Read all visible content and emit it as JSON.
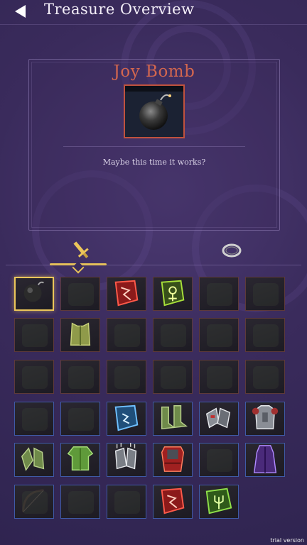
{
  "header": {
    "title": "Treasure Overview",
    "back_icon": "back-arrow-icon"
  },
  "detail": {
    "item_name": "Joy Bomb",
    "item_icon": "bomb-icon",
    "description": "Maybe this time it works?",
    "name_color": "#d2664f"
  },
  "tabs": [
    {
      "icon": "sword-icon",
      "selected": true
    },
    {
      "icon": "ring-icon",
      "selected": false
    }
  ],
  "slots": [
    {
      "icon": "bomb-icon",
      "state": "selected"
    },
    {
      "icon": "empty-slot-icon",
      "state": "locked"
    },
    {
      "icon": "red-rune-icon",
      "state": "owned"
    },
    {
      "icon": "green-rune-icon",
      "state": "owned"
    },
    {
      "icon": "locked-item-icon",
      "state": "locked"
    },
    {
      "icon": "locked-item-icon",
      "state": "locked"
    },
    {
      "icon": "locked-item-icon",
      "state": "locked"
    },
    {
      "icon": "leather-vest-icon",
      "state": "owned"
    },
    {
      "icon": "locked-item-icon",
      "state": "locked"
    },
    {
      "icon": "locked-item-icon",
      "state": "locked"
    },
    {
      "icon": "locked-item-icon",
      "state": "locked"
    },
    {
      "icon": "locked-item-icon",
      "state": "locked"
    },
    {
      "icon": "locked-item-icon",
      "state": "locked"
    },
    {
      "icon": "locked-item-icon",
      "state": "locked"
    },
    {
      "icon": "locked-item-icon",
      "state": "locked"
    },
    {
      "icon": "locked-item-icon",
      "state": "locked"
    },
    {
      "icon": "locked-item-icon",
      "state": "locked"
    },
    {
      "icon": "locked-item-icon",
      "state": "locked"
    },
    {
      "icon": "locked-item-icon",
      "state": "locked"
    },
    {
      "icon": "locked-item-icon",
      "state": "locked"
    },
    {
      "icon": "blue-rune-icon",
      "state": "owned"
    },
    {
      "icon": "green-boots-icon",
      "state": "owned"
    },
    {
      "icon": "steel-gauntlets-icon",
      "state": "owned"
    },
    {
      "icon": "plate-armor-icon",
      "state": "owned"
    },
    {
      "icon": "green-gloves-icon",
      "state": "owned"
    },
    {
      "icon": "green-tunic-icon",
      "state": "owned"
    },
    {
      "icon": "clawed-gauntlets-icon",
      "state": "owned"
    },
    {
      "icon": "red-armor-icon",
      "state": "owned"
    },
    {
      "icon": "locked-item-icon",
      "state": "locked"
    },
    {
      "icon": "purple-robe-icon",
      "state": "owned"
    },
    {
      "icon": "bow-icon",
      "state": "locked"
    },
    {
      "icon": "locked-item-icon",
      "state": "locked"
    },
    {
      "icon": "locked-item-icon",
      "state": "locked"
    },
    {
      "icon": "red-rune-icon",
      "state": "owned"
    },
    {
      "icon": "green-trident-rune-icon",
      "state": "owned"
    }
  ],
  "watermark": "trial version"
}
